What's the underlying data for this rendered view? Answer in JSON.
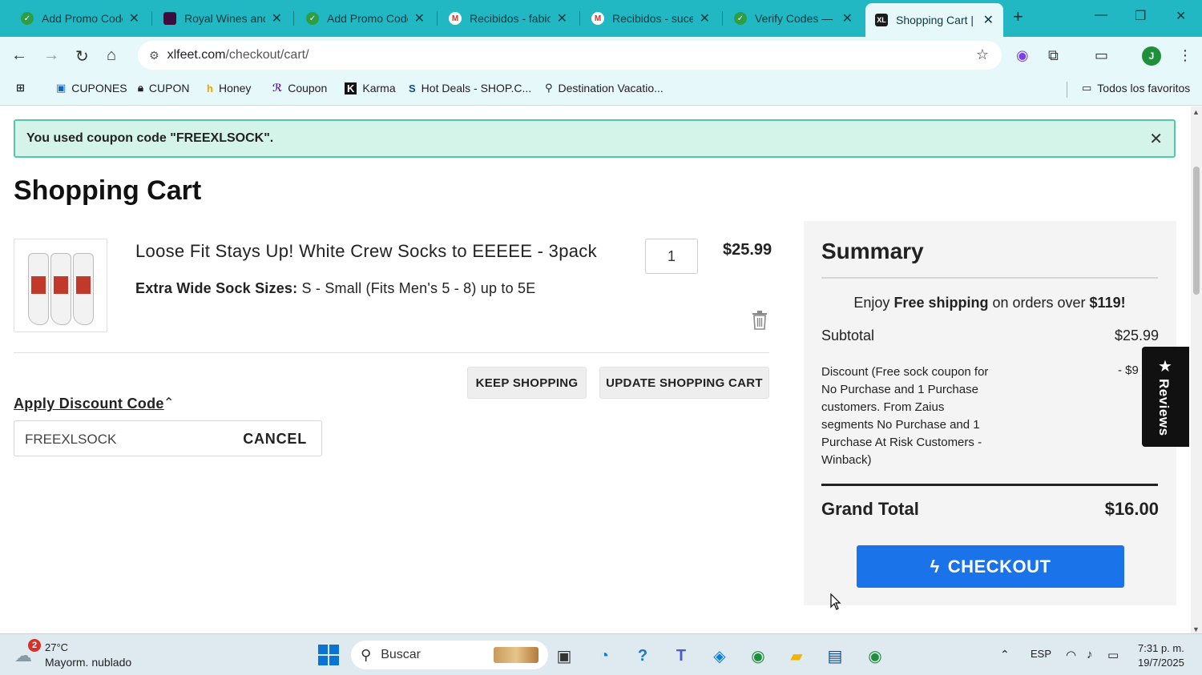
{
  "browser": {
    "tabs": [
      {
        "title": "Add Promo Code",
        "icon": "coupon-site-icon"
      },
      {
        "title": "Royal Wines and",
        "icon": "royal-wines-icon"
      },
      {
        "title": "Add Promo Code",
        "icon": "coupon-site-icon"
      },
      {
        "title": "Recibidos - fabio",
        "icon": "gmail-icon"
      },
      {
        "title": "Recibidos - suces",
        "icon": "gmail-icon"
      },
      {
        "title": "Verify Codes — S",
        "icon": "coupon-site-icon"
      },
      {
        "title": "Shopping Cart | X",
        "icon": "xlfeet-icon",
        "active": true
      }
    ],
    "url_domain": "xlfeet.com",
    "url_path": "/checkout/cart/",
    "profile_initial": "J",
    "bookmarks": [
      {
        "label": "CUPONES",
        "icon": "bookmark-cupones-icon"
      },
      {
        "label": "CUPON",
        "icon": "lock-icon"
      },
      {
        "label": "Honey",
        "icon": "honey-icon"
      },
      {
        "label": "Coupon",
        "icon": "coupon-icon"
      },
      {
        "label": "Karma",
        "icon": "karma-icon"
      },
      {
        "label": "Hot Deals - SHOP.C...",
        "icon": "shop-icon"
      },
      {
        "label": "Destination Vacatio...",
        "icon": "map-pin-icon"
      }
    ],
    "all_bookmarks": "Todos los favoritos"
  },
  "page": {
    "message": "You used coupon code \"FREEXLSOCK\".",
    "title": "Shopping Cart",
    "item": {
      "name": "Loose Fit Stays Up! White Crew Socks to EEEEE - 3pack",
      "option_label": "Extra Wide Sock Sizes:",
      "option_value": "S - Small (Fits Men's 5 - 8) up to 5E",
      "qty": "1",
      "price": "$25.99"
    },
    "keep_shopping": "KEEP SHOPPING",
    "update_cart": "UPDATE SHOPPING CART",
    "discount_title": "Apply Discount Code",
    "discount_value": "FREEXLSOCK",
    "cancel": "CANCEL"
  },
  "summary": {
    "title": "Summary",
    "ship_enjoy": "Enjoy",
    "ship_free": "Free shipping",
    "ship_mid": "on orders over",
    "ship_amount": "$119!",
    "subtotal_label": "Subtotal",
    "subtotal_value": "$25.99",
    "discount_label": "Discount (Free sock coupon for No Purchase and 1 Purchase customers. From Zaius segments No Purchase and 1 Purchase At Risk Customers - Winback)",
    "discount_value": "- $9",
    "grand_total_label": "Grand Total",
    "grand_total_value": "$16.00",
    "checkout": "CHECKOUT",
    "reviews": "Reviews"
  },
  "taskbar": {
    "weather_badge": "2",
    "temperature": "27°C",
    "weather": "Mayorm. nublado",
    "search_placeholder": "Buscar",
    "language": "ESP",
    "time": "7:31 p. m.",
    "date": "19/7/2025"
  },
  "colors": {
    "tabstrip": "#21b8c4",
    "success_bg": "#d4f4ea",
    "checkout": "#1a73e8"
  }
}
